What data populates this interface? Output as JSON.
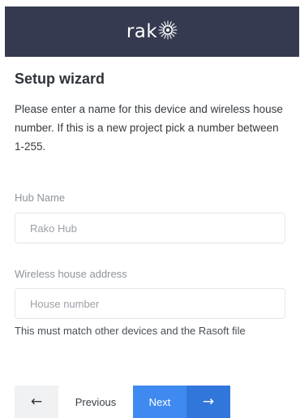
{
  "header": {
    "logo_text": "rak",
    "logo_icon": "sunburst-icon"
  },
  "wizard": {
    "title": "Setup wizard",
    "description": "Please enter a name for this device and wireless house number. If this is a new project pick a number between 1-255."
  },
  "form": {
    "hub_name": {
      "label": "Hub Name",
      "value": "",
      "placeholder": "Rako Hub"
    },
    "house_address": {
      "label": "Wireless house address",
      "value": "",
      "placeholder": "House number",
      "hint": "This must match other devices and the Rasoft file"
    }
  },
  "navigation": {
    "back_icon": "arrow-left-icon",
    "back_glyph": "←",
    "previous_label": "Previous",
    "next_label": "Next",
    "forward_icon": "arrow-right-icon",
    "forward_glyph": "→"
  },
  "colors": {
    "header_bg": "#353a51",
    "primary": "#3f8af0",
    "primary_dark": "#3176da"
  }
}
